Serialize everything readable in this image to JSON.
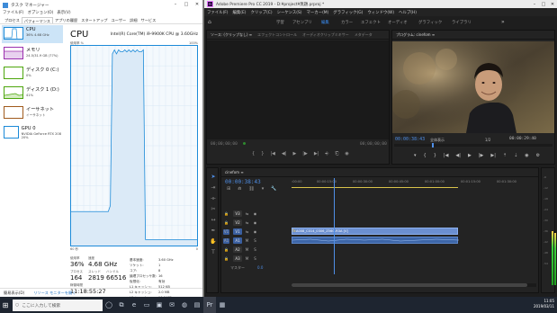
{
  "taskmanager": {
    "title": "タスク マネージャー",
    "menu": [
      "ファイル(F)",
      "オプション(O)",
      "表示(V)"
    ],
    "tabs": [
      "プロセス",
      "パフォーマンス",
      "アプリの履歴",
      "スタートアップ",
      "ユーザー",
      "詳細",
      "サービス"
    ],
    "sidebar": [
      {
        "name": "CPU",
        "sub": "36%  4.68 GHz"
      },
      {
        "name": "メモリ",
        "sub": "24.5/31.9 GB (77%)"
      },
      {
        "name": "ディスク 0 (C:)",
        "sub": "0%"
      },
      {
        "name": "ディスク 1 (D:)",
        "sub": "41%"
      },
      {
        "name": "イーサネット",
        "sub": "イーサネット"
      },
      {
        "name": "GPU 0",
        "sub": "NVIDIA GeForce RTX 208\n20%"
      }
    ],
    "cpu_title": "CPU",
    "cpu_model": "Intel(R) Core(TM) i9-9900K CPU @ 3.60GHz",
    "graph_label": "使用率 %",
    "graph_max": "100%",
    "graph_time": "60 秒",
    "graph_min": "0",
    "usage_series": [
      17,
      17,
      17,
      17,
      17,
      17,
      17,
      17,
      17,
      17,
      17,
      17,
      17,
      17,
      17,
      17,
      17,
      17,
      17,
      20,
      96,
      98,
      96,
      98,
      97,
      97,
      98,
      97,
      98,
      97,
      98,
      97,
      98,
      97,
      97,
      98,
      3,
      3,
      3,
      3,
      3,
      3,
      3,
      3,
      3,
      3,
      3,
      3,
      3,
      3,
      3,
      3,
      3,
      3,
      3,
      3,
      3,
      3,
      3,
      3,
      3,
      3
    ],
    "stats": {
      "usage_label": "使用率",
      "usage": "36%",
      "speed_label": "速度",
      "speed": "4.68 GHz",
      "proc_label": "プロセス",
      "proc": "164",
      "threads_label": "スレッド",
      "threads": "2819",
      "handles_label": "ハンドル",
      "handles": "66516",
      "uptime_label": "稼働時間",
      "uptime": "11:18:55:27"
    },
    "details": [
      [
        "基本速度:",
        "3.60 GHz"
      ],
      [
        "ソケット:",
        "1"
      ],
      [
        "コア:",
        "8"
      ],
      [
        "論理プロセッサ数:",
        "16"
      ],
      [
        "仮想化:",
        "有効"
      ],
      [
        "L1 キャッシュ:",
        "512 KB"
      ],
      [
        "L2 キャッシュ:",
        "2.0 MB"
      ],
      [
        "L3 キャッシュ:",
        "16.0 MB"
      ]
    ],
    "footer": [
      "簡易表示(D)",
      "リソース モニターを開く"
    ]
  },
  "premiere": {
    "title": "Adobe Premiere Pro CC 2019 - D:¥project¥無題.prproj *",
    "menu": [
      "ファイル(F)",
      "編集(E)",
      "クリップ(C)",
      "シーケンス(S)",
      "マーカー(M)",
      "グラフィック(G)",
      "ウィンドウ(W)",
      "ヘルプ(H)"
    ],
    "workspaces": [
      "学習",
      "アセンブリ",
      "編集",
      "カラー",
      "エフェクト",
      "オーディオ",
      "グラフィック",
      "ライブラリ"
    ],
    "source_tabs": [
      "ソース: (クリップなし) ≡",
      "エフェクトコントロール",
      "オーディオクリップミキサー",
      "メタデータ"
    ],
    "program_tab": "プログラム: cinefom ≡",
    "source_tc_left": "00;00;00;00",
    "source_tc_right": "00;00;00;00",
    "program_tc": "00:00:38:43",
    "program_fit": "全体表示",
    "program_fraction": "1/2",
    "program_duration": "00:00:29:40",
    "sequence_tab": "cinefom ≡",
    "timeline_tc": "00:00:38:43",
    "ruler_marks": [
      ":00:00",
      "00:00:15:00",
      "00:00:30:00",
      "00:00:45:00",
      "00:01:00:00",
      "00:01:15:00",
      "00:01:30:00",
      "00:01:45:00"
    ],
    "tracks": [
      {
        "name": "V3"
      },
      {
        "name": "V2"
      },
      {
        "name": "V1"
      },
      {
        "name": "A1"
      },
      {
        "name": "A2"
      },
      {
        "name": "A3"
      }
    ],
    "master_label": "マスター",
    "master_value": "0.0",
    "clip_label": "A008_C014_0306_Z56G.R3A [V]",
    "meter_marks": [
      "-6",
      "-12",
      "-18",
      "-24",
      "-30",
      "-36",
      "-42",
      "-48",
      "-54"
    ]
  },
  "taskbar": {
    "search": "ここに入力して検索",
    "time": "11:05",
    "date": "2019/03/11"
  }
}
